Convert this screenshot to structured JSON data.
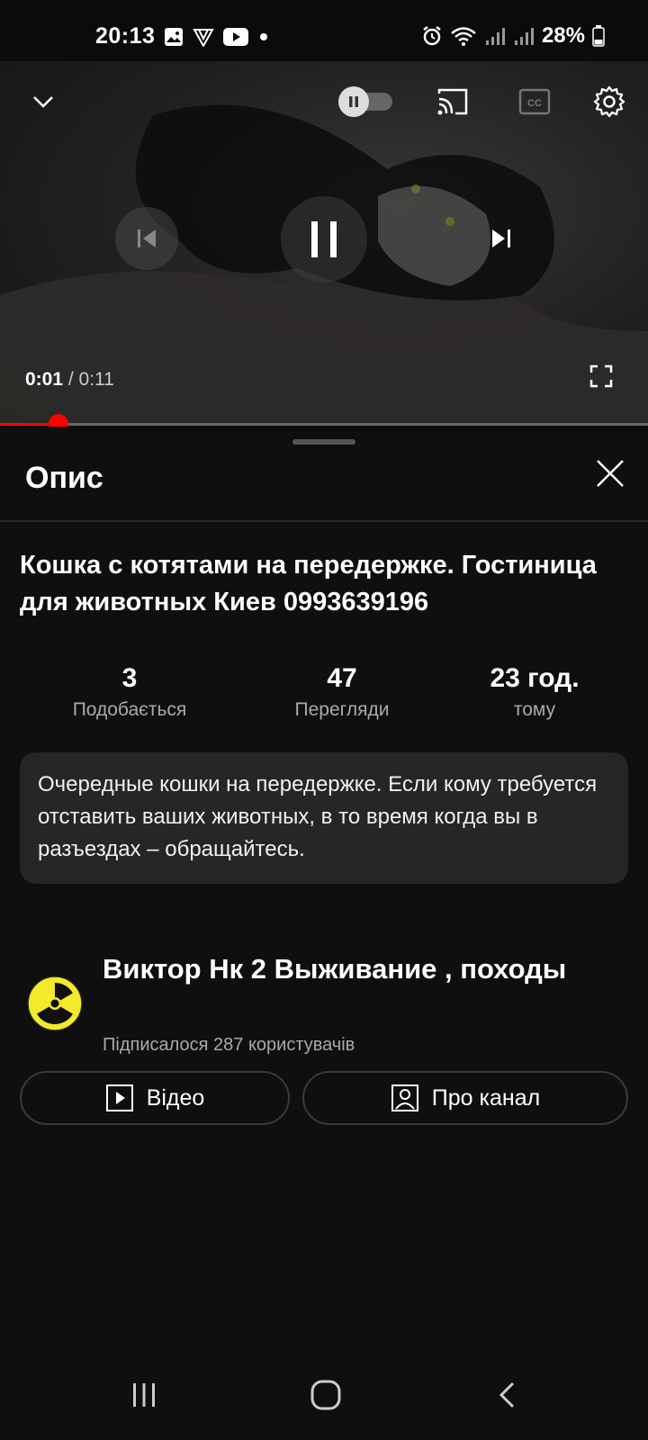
{
  "status_bar": {
    "time": "20:13",
    "battery": "28%",
    "icons": [
      "gallery-icon",
      "vpn-icon",
      "youtube-icon",
      "dot-icon",
      "alarm-icon",
      "wifi-icon",
      "signal-icon",
      "signal-icon",
      "battery-icon"
    ]
  },
  "player": {
    "current_time": "0:01",
    "separator": " / ",
    "duration": "0:11",
    "progress": 0.09,
    "autoplay_on": false,
    "icons": [
      "collapse-icon",
      "autoplay-toggle-icon",
      "cast-icon",
      "captions-icon",
      "settings-icon",
      "previous-icon",
      "pause-icon",
      "next-icon",
      "fullscreen-icon"
    ]
  },
  "panel": {
    "title": "Опис",
    "video_title": "Кошка с котятами на передержке. Гостиница для животных Киев 0993639196",
    "stats": [
      {
        "value": "3",
        "label": "Подобається"
      },
      {
        "value": "47",
        "label": "Перегляди"
      },
      {
        "value": "23 год.",
        "label": "тому"
      }
    ],
    "description": "Очередные кошки на передержке. Если кому требуется отставить ваших животных, в то время когда вы в разъездах – обращайтесь.",
    "channel": {
      "name": "Виктор Нк 2 Выживание , походы",
      "subscribers": "Підписалося 287 користувачів",
      "videos_button": "Відео",
      "about_button": "Про канал"
    }
  },
  "colors": {
    "background": "#0f0f0f",
    "progress": "#ff0000",
    "card": "#262626",
    "secondary_text": "#aaaaaa"
  }
}
